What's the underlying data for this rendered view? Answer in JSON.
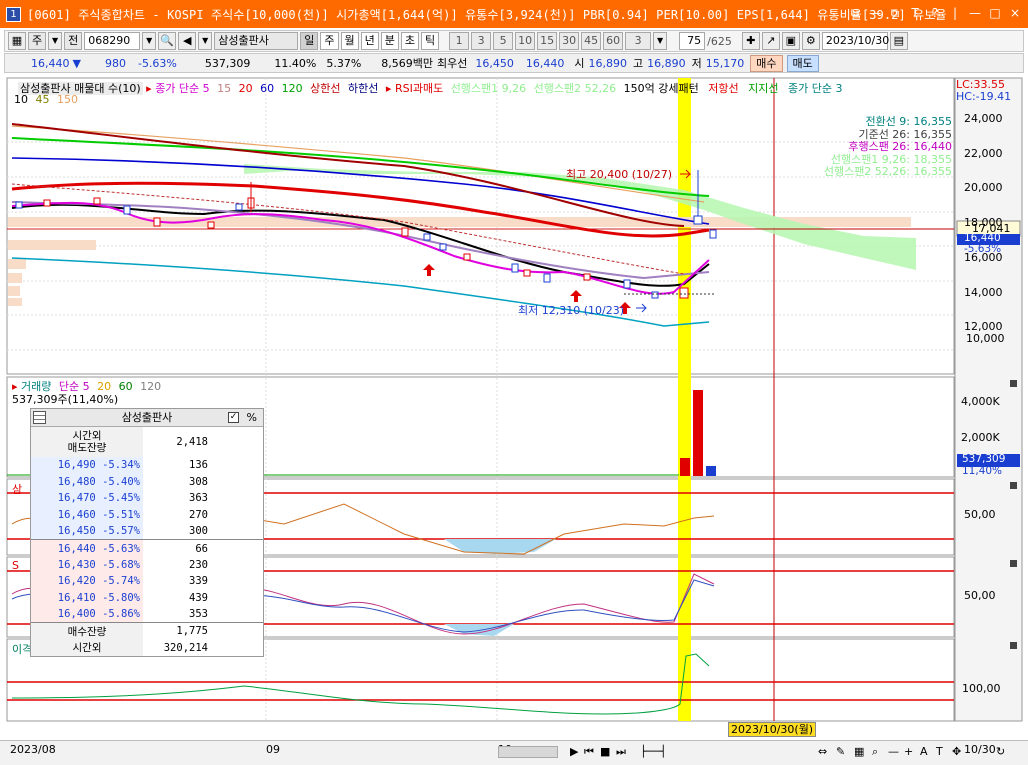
{
  "titlebar": {
    "badge": "1",
    "title": "[0601] 주식종합차트 - KOSPI 주식수[10,000(천)] 시가총액[1,644(억)] 유통수[3,924(천)] PBR[0.94] PER[10.00] EPS[1,644] 유통비율[39.2] 유보율",
    "buttons": [
      "⧉",
      "—",
      "⧉",
      "T",
      "?",
      "|",
      "—",
      "□",
      "×"
    ]
  },
  "toolbar": {
    "type": "주",
    "prev": "전",
    "code": "068290",
    "name": "삼성출판사",
    "periods": [
      "일",
      "주",
      "월",
      "년",
      "분",
      "초",
      "틱"
    ],
    "intervals": [
      "1",
      "3",
      "5",
      "10",
      "15",
      "30",
      "45",
      "60"
    ],
    "interval_value": "3",
    "count": "75",
    "total": "/625",
    "date": "2023/10/30"
  },
  "quote": {
    "price": "16,440",
    "change": "980",
    "change_pct": "-5.63%",
    "volume": "537,309",
    "turnover_pct": "11.40%",
    "ratio": "5.37%",
    "amount": "8,569백만",
    "best_label": "최우선",
    "ask": "16,450",
    "bid": "16,440",
    "open_label": "시",
    "open": "16,890",
    "high_label": "고",
    "high": "16,890",
    "low_label": "저",
    "low": "15,170",
    "buy": "매수",
    "sell": "매도"
  },
  "legends": {
    "main": [
      {
        "text": "삼성출판사 매물대 수(10)",
        "color": "#000000"
      },
      {
        "text": "종가 단순 5",
        "color": "#d000d0"
      },
      {
        "text": "15",
        "color": "#c08080"
      },
      {
        "text": "20",
        "color": "#e00000"
      },
      {
        "text": "60",
        "color": "#0000c0"
      },
      {
        "text": "120",
        "color": "#00a000"
      },
      {
        "text": "상한선",
        "color": "#c00000"
      },
      {
        "text": "하한선",
        "color": "#000080"
      },
      {
        "text": "RSI과매도",
        "color": "#e00000"
      },
      {
        "text": "선행스팬1 9,26",
        "color": "#90ee90"
      },
      {
        "text": "선행스팬2 52,26",
        "color": "#90ee90"
      },
      {
        "text": "150억 강세패턴",
        "color": "#000000"
      },
      {
        "text": "저항선",
        "color": "#e00000"
      },
      {
        "text": "지지선",
        "color": "#00a000"
      },
      {
        "text": "종가 단순 3",
        "color": "#008080"
      }
    ],
    "main2": [
      "10",
      "45",
      "150"
    ],
    "ichimoku": [
      {
        "text": "전환선 9: 16,355",
        "color": "#008080"
      },
      {
        "text": "기준선 26: 16,355",
        "color": "#404040"
      },
      {
        "text": "후행스팬 26: 16,440",
        "color": "#c000c0"
      },
      {
        "text": "선행스팬1 9,26: 18,355",
        "color": "#90ee90"
      },
      {
        "text": "선행스팬2 52,26: 16,355",
        "color": "#90ee90"
      }
    ],
    "lc": "LC:33.55",
    "hc": "HC:-19.41",
    "volume": [
      {
        "text": "거래량",
        "color": "#008080"
      },
      {
        "text": "단순 5",
        "color": "#c000c0"
      },
      {
        "text": "20",
        "color": "#e0a000"
      },
      {
        "text": "60",
        "color": "#008000"
      },
      {
        "text": "120",
        "color": "#808080"
      }
    ],
    "volume_value": "537,309주(11,40%)",
    "pane3_label": "삼",
    "pane4_label": "S",
    "pane5_label": "이격"
  },
  "annotations": {
    "high": "최고 20,400 (10/27)",
    "low": "최저 12,310 (10/23)"
  },
  "axis": {
    "price_ticks": [
      "24,000",
      "22,000",
      "20,000",
      "18,000",
      "16,000",
      "14,000",
      "12,000",
      "10,000"
    ],
    "last_price": "17,041",
    "cur_price": "16,440",
    "cur_pct": "-5.63%",
    "volume_ticks": [
      "4,000K",
      "2,000K"
    ],
    "vol_cur": "537,309",
    "vol_pct": "11,40%",
    "pane3_tick": "50,00",
    "pane4_tick": "50,00",
    "pane5_tick": "100,00",
    "date_labels": [
      "2023/08",
      "09",
      "10"
    ],
    "right_date": "10/30",
    "cursor_date": "2023/10/30(월)"
  },
  "orderbook": {
    "title": "삼성출판사",
    "pct_label": "%",
    "top_label": "시간외\n매도잔량",
    "top_value": "2,418",
    "asks": [
      {
        "price": "16,490",
        "pct": "-5.34%",
        "qty": "136"
      },
      {
        "price": "16,480",
        "pct": "-5.40%",
        "qty": "308"
      },
      {
        "price": "16,470",
        "pct": "-5.45%",
        "qty": "363"
      },
      {
        "price": "16,460",
        "pct": "-5.51%",
        "qty": "270"
      },
      {
        "price": "16,450",
        "pct": "-5.57%",
        "qty": "300"
      }
    ],
    "bids": [
      {
        "price": "16,440",
        "pct": "-5.63%",
        "qty": "66"
      },
      {
        "price": "16,430",
        "pct": "-5.68%",
        "qty": "230"
      },
      {
        "price": "16,420",
        "pct": "-5.74%",
        "qty": "339"
      },
      {
        "price": "16,410",
        "pct": "-5.80%",
        "qty": "439"
      },
      {
        "price": "16,400",
        "pct": "-5.86%",
        "qty": "353"
      }
    ],
    "bid_total_label": "매수잔량",
    "bid_total": "1,775",
    "after_label": "시간외",
    "after_value": "320,214"
  }
}
